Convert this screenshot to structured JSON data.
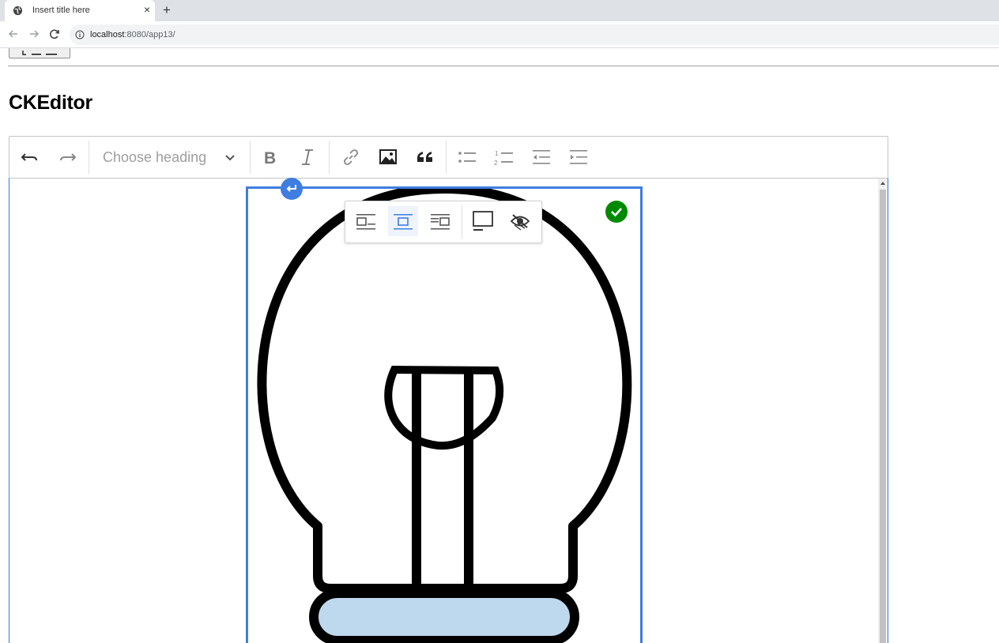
{
  "browser": {
    "tab_title": "Insert title here",
    "tab_close": "×",
    "new_tab": "+",
    "url_host": "localhost",
    "url_rest": ":8080/app13/"
  },
  "page": {
    "heading": "CKEditor"
  },
  "toolbar": {
    "heading_dropdown_label": "Choose heading",
    "items": [
      "undo-icon",
      "redo-icon",
      "bold-icon",
      "italic-icon",
      "link-icon",
      "image-icon",
      "blockquote-icon",
      "bulleted-list-icon",
      "numbered-list-icon",
      "outdent-icon",
      "indent-icon"
    ]
  },
  "image_toolbar": {
    "items": [
      "image-align-left-icon",
      "image-align-center-icon",
      "image-align-right-icon",
      "image-fullwidth-icon",
      "hide-icon"
    ],
    "active": "image-align-center-icon"
  },
  "colors": {
    "selection": "#3f7de0",
    "check": "#008a00",
    "bulb_base": "#bed8ee"
  }
}
